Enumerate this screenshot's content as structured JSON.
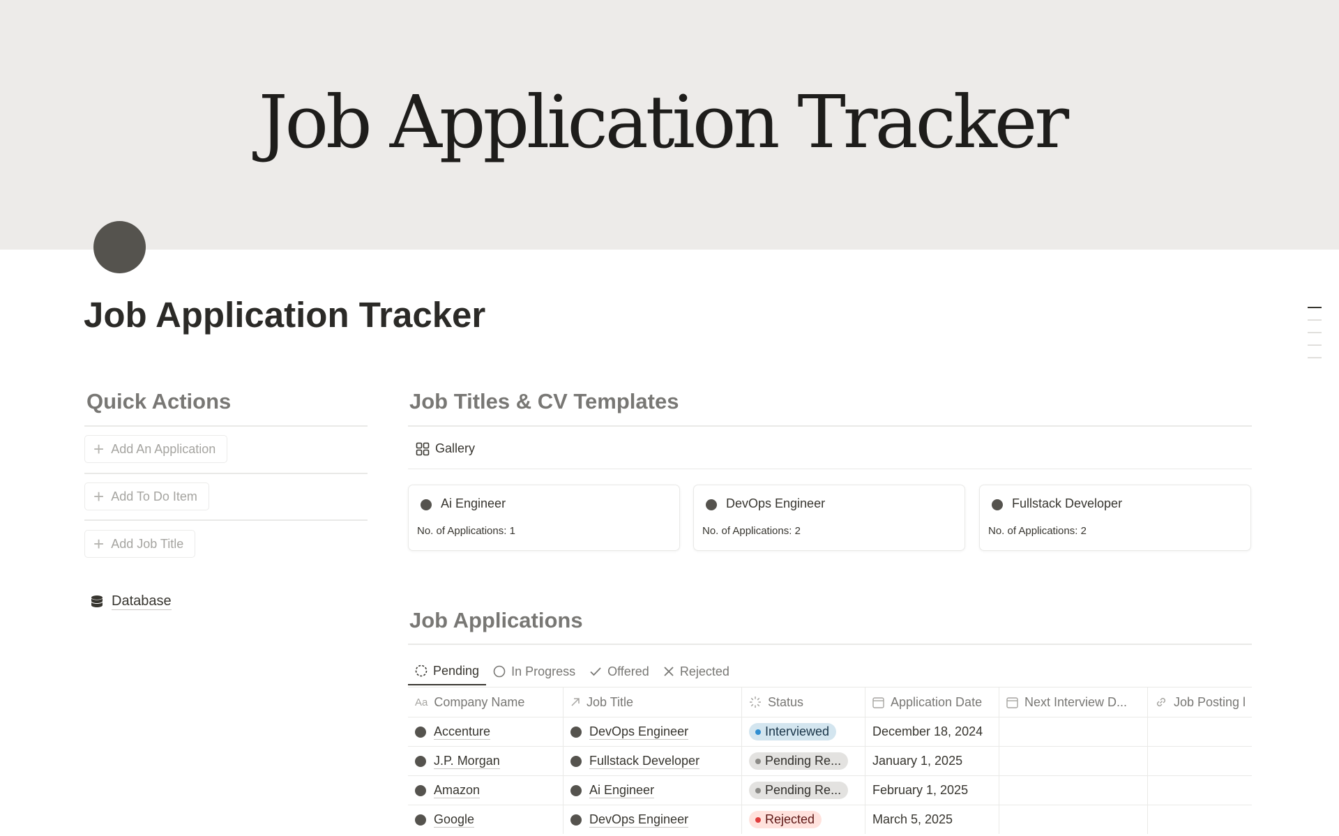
{
  "cover": {
    "title": "Job Application Tracker"
  },
  "page": {
    "title": "Job Application Tracker"
  },
  "quick_actions": {
    "heading": "Quick Actions",
    "buttons": [
      {
        "label": "Add An Application"
      },
      {
        "label": "Add To Do Item"
      },
      {
        "label": "Add Job Title"
      }
    ],
    "database_link": "Database"
  },
  "job_titles": {
    "heading": "Job Titles & CV Templates",
    "view_tab": "Gallery",
    "cards": [
      {
        "name": "Ai Engineer",
        "meta": "No. of Applications: 1"
      },
      {
        "name": "DevOps Engineer",
        "meta": "No. of Applications: 2"
      },
      {
        "name": "Fullstack Developer",
        "meta": "No. of Applications: 2"
      }
    ]
  },
  "applications": {
    "heading": "Job Applications",
    "tabs": [
      {
        "label": "Pending",
        "icon": "dashed-circle-icon",
        "active": true
      },
      {
        "label": "In Progress",
        "icon": "circle-icon"
      },
      {
        "label": "Offered",
        "icon": "check-icon"
      },
      {
        "label": "Rejected",
        "icon": "x-icon"
      }
    ],
    "columns": [
      {
        "label": "Company Name",
        "icon": "Aa"
      },
      {
        "label": "Job Title",
        "icon": "relation-arrow-icon"
      },
      {
        "label": "Status",
        "icon": "status-icon"
      },
      {
        "label": "Application Date",
        "icon": "calendar-icon"
      },
      {
        "label": "Next Interview D...",
        "icon": "calendar-icon"
      },
      {
        "label": "Job Posting l",
        "icon": "link-icon"
      }
    ],
    "rows": [
      {
        "company": "Accenture",
        "job": "DevOps Engineer",
        "status": "Interviewed",
        "status_color": "blue",
        "date": "December 18, 2024"
      },
      {
        "company": "J.P. Morgan",
        "job": "Fullstack Developer",
        "status": "Pending Re...",
        "status_color": "gray",
        "date": "January 1, 2025"
      },
      {
        "company": "Amazon",
        "job": "Ai Engineer",
        "status": "Pending Re...",
        "status_color": "gray",
        "date": "February 1, 2025"
      },
      {
        "company": "Google",
        "job": "DevOps Engineer",
        "status": "Rejected",
        "status_color": "red",
        "date": "March 5, 2025"
      }
    ]
  }
}
